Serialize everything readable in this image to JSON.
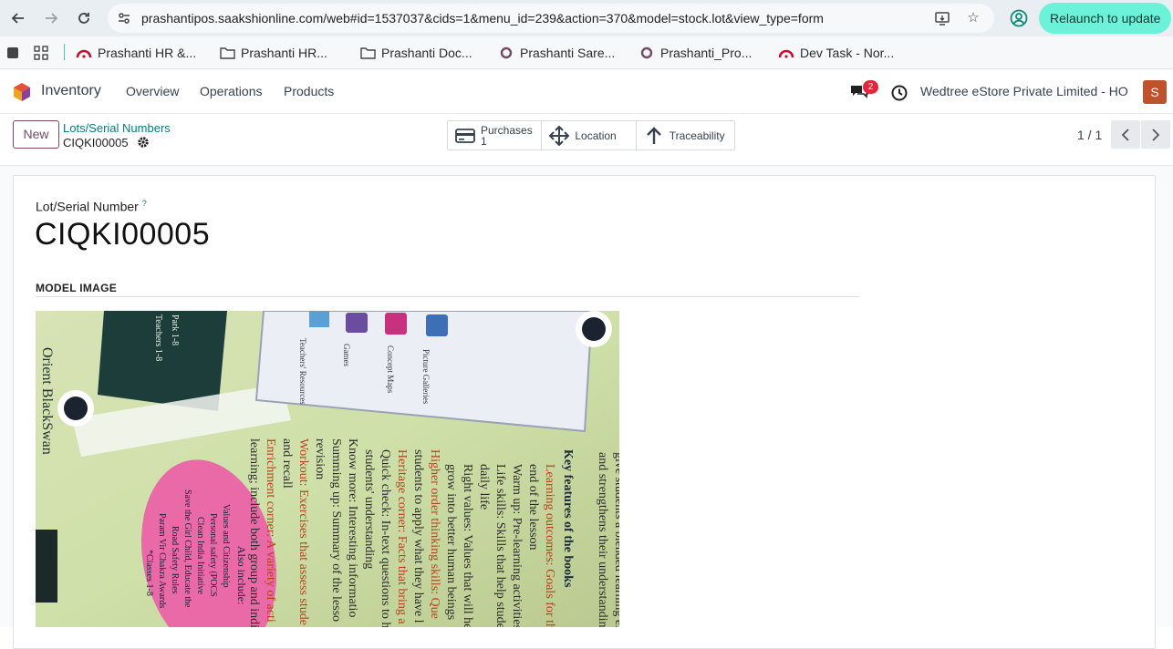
{
  "browser": {
    "url": "prashantipos.saakshionline.com/web#id=1537037&cids=1&menu_id=239&action=370&model=stock.lot&view_type=form",
    "relaunch_label": "Relaunch to update",
    "bookmarks": [
      {
        "label": "Prashanti HR &...",
        "icon": "odoo-icon"
      },
      {
        "label": "Prashanti HR...",
        "icon": "folder-icon"
      },
      {
        "label": "Prashanti Doc...",
        "icon": "folder-icon"
      },
      {
        "label": "Prashanti Sare...",
        "icon": "circle-icon"
      },
      {
        "label": "Prashanti_Pro...",
        "icon": "circle-icon"
      },
      {
        "label": "Dev Task - Nor...",
        "icon": "odoo-icon"
      }
    ]
  },
  "navbar": {
    "app_name": "Inventory",
    "menus": [
      "Overview",
      "Operations",
      "Products"
    ],
    "chat_count": "2",
    "company": "Wedtree eStore Private Limited - HO",
    "avatar_initial": "S"
  },
  "control_panel": {
    "new_label": "New",
    "breadcrumb_parent": "Lots/Serial Numbers",
    "breadcrumb_current": "CIQKI00005",
    "smart_buttons": {
      "purchases_label": "Purchases",
      "purchases_count": "1",
      "location_label": "Location",
      "traceability_label": "Traceability"
    },
    "pager": "1 / 1"
  },
  "form": {
    "field_label": "Lot/Serial Number",
    "help_mark": "?",
    "lot_name": "CIQKI00005",
    "section_title": "MODEL IMAGE"
  },
  "image_text": {
    "brand": "Orient BlackSwan",
    "top_card_lines": [
      "Teachers' Resources",
      "Games",
      "Concept Maps",
      "Picture Galleries"
    ],
    "heading": "Key features of the books",
    "lines": [
      "give students a blended learning experience",
      "and strengthens their understanding",
      "Learning outcomes: Goals for the",
      "end of the lesson",
      "Warm up: Pre-learning activities",
      "Life skills: Skills that help students",
      "daily life",
      "Right values: Values that will help",
      "grow into better human beings",
      "Higher order thinking skills: Que",
      "students to apply what they have l",
      "Heritage corner: Facts that bring a",
      "Quick check: In-text questions to h",
      "students' understanding",
      "Know more: Interesting informatio",
      "Summing up: Summary of the lesso",
      "revision",
      "Workout: Exercises that assess stude",
      "and recall",
      "Enrichment corner: A variety of acti",
      "learning; include both group and indi"
    ],
    "oval_lines": [
      "Also include:",
      "Values and Citizenship",
      "Personal safety (POCS",
      "Clean India Initiative",
      "Save the Girl Child, Educate the",
      "Road Safety Rules",
      "Param Vir Chakra Awards",
      "*Classes 1-8"
    ],
    "strip_lines": [
      "Park 1-8",
      "Teachers 1-8"
    ]
  }
}
